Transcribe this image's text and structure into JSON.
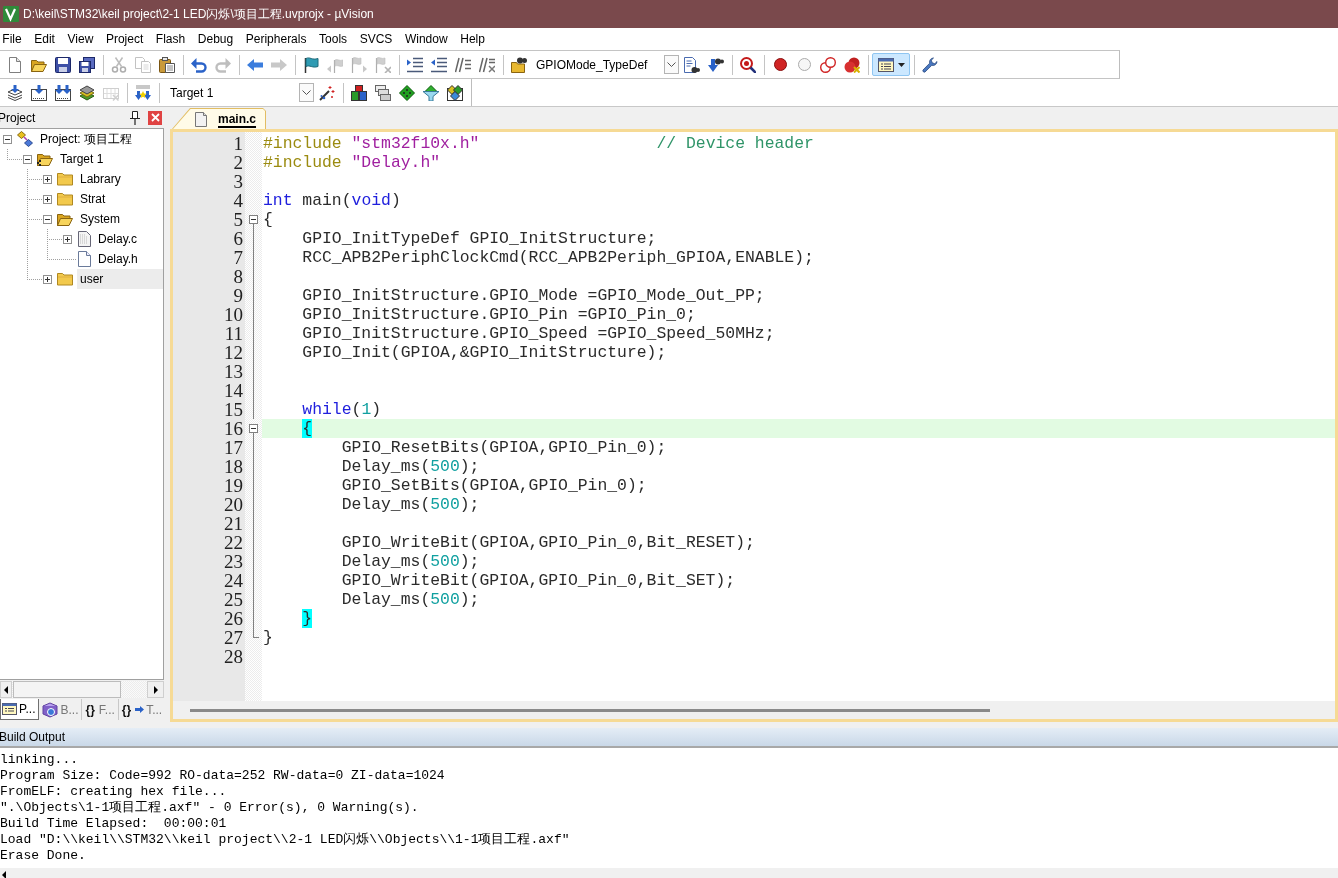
{
  "window": {
    "title": "D:\\keil\\STM32\\keil project\\2-1 LED闪烁\\项目工程.uvprojx - µVision"
  },
  "menu": [
    "File",
    "Edit",
    "View",
    "Project",
    "Flash",
    "Debug",
    "Peripherals",
    "Tools",
    "SVCS",
    "Window",
    "Help"
  ],
  "toolbar_1": [
    [
      {
        "kind": "new_file",
        "disabled": false,
        "pressed": false
      },
      {
        "kind": "open",
        "disabled": false,
        "pressed": false
      },
      {
        "kind": "save",
        "disabled": false,
        "pressed": false
      },
      {
        "kind": "save_all",
        "disabled": false,
        "pressed": false
      }
    ],
    [
      {
        "kind": "cut",
        "disabled": true,
        "pressed": false
      },
      {
        "kind": "copy",
        "disabled": true,
        "pressed": false
      },
      {
        "kind": "paste",
        "disabled": false,
        "pressed": false
      }
    ],
    [
      {
        "kind": "undo",
        "disabled": false,
        "pressed": false
      },
      {
        "kind": "redo",
        "disabled": true,
        "pressed": false
      }
    ],
    [
      {
        "kind": "nav_back",
        "disabled": false,
        "pressed": false
      },
      {
        "kind": "nav_forward",
        "disabled": true,
        "pressed": false
      }
    ],
    [
      {
        "kind": "bookmark",
        "disabled": false,
        "pressed": false
      },
      {
        "kind": "bookmark_prev",
        "disabled": true,
        "pressed": false
      },
      {
        "kind": "bookmark_next",
        "disabled": true,
        "pressed": false
      },
      {
        "kind": "bookmark_clear",
        "disabled": true,
        "pressed": false
      }
    ],
    [
      {
        "kind": "indent",
        "disabled": false,
        "pressed": false
      },
      {
        "kind": "unindent",
        "disabled": false,
        "pressed": false
      },
      {
        "kind": "comment",
        "disabled": false,
        "pressed": false
      },
      {
        "kind": "uncomment",
        "disabled": false,
        "pressed": false
      }
    ],
    [
      {
        "kind": "find_in_files",
        "disabled": false,
        "pressed": false
      },
      {
        "kind": "combo",
        "value": "GPIOMode_TypeDef"
      },
      {
        "kind": "find",
        "disabled": false,
        "pressed": false
      },
      {
        "kind": "incremental_find",
        "disabled": false,
        "pressed": false
      }
    ],
    [
      {
        "kind": "debug",
        "disabled": false,
        "pressed": false
      }
    ],
    [
      {
        "kind": "breakpoint",
        "disabled": false,
        "pressed": false
      },
      {
        "kind": "breakpoint_toggle",
        "disabled": false,
        "pressed": false
      },
      {
        "kind": "breakpoint_disable_all",
        "disabled": false,
        "pressed": false
      },
      {
        "kind": "breakpoint_kill_all",
        "disabled": false,
        "pressed": false
      }
    ],
    [
      {
        "kind": "windows",
        "disabled": false,
        "pressed": true
      }
    ],
    [
      {
        "kind": "configure",
        "disabled": false,
        "pressed": false
      }
    ]
  ],
  "toolbar_2": [
    [
      {
        "kind": "translate",
        "disabled": false,
        "pressed": false
      },
      {
        "kind": "build",
        "disabled": false,
        "pressed": false
      },
      {
        "kind": "rebuild",
        "disabled": false,
        "pressed": false
      },
      {
        "kind": "batch_build",
        "disabled": false,
        "pressed": false
      },
      {
        "kind": "stop_build",
        "disabled": true,
        "pressed": false
      }
    ],
    [
      {
        "kind": "download",
        "disabled": false,
        "pressed": false
      }
    ],
    [
      {
        "kind": "combo",
        "value": "Target 1"
      },
      {
        "kind": "target_options",
        "disabled": false,
        "pressed": false
      }
    ],
    [
      {
        "kind": "manage_components",
        "disabled": false,
        "pressed": false
      },
      {
        "kind": "select_packs",
        "disabled": false,
        "pressed": false
      },
      {
        "kind": "run_time_env",
        "disabled": false,
        "pressed": false
      },
      {
        "kind": "pack_filter",
        "disabled": false,
        "pressed": false
      },
      {
        "kind": "pack_installer",
        "disabled": false,
        "pressed": false
      }
    ]
  ],
  "project_panel": {
    "title": "Project",
    "tree": [
      {
        "label": "Project: 项目工程",
        "kind": "project",
        "expanded": true,
        "selected": false,
        "children": [
          {
            "label": "Target 1",
            "kind": "target",
            "expanded": true,
            "selected": false,
            "children": [
              {
                "label": "Labrary",
                "kind": "group",
                "expanded": false,
                "selected": false
              },
              {
                "label": "Strat",
                "kind": "group",
                "expanded": false,
                "selected": false
              },
              {
                "label": "System",
                "kind": "group",
                "expanded": true,
                "selected": false,
                "children": [
                  {
                    "label": "Delay.c",
                    "kind": "source",
                    "expanded": false,
                    "selected": false
                  },
                  {
                    "label": "Delay.h",
                    "kind": "header",
                    "selected": false
                  }
                ]
              },
              {
                "label": "user",
                "kind": "group",
                "expanded": false,
                "selected": true
              }
            ]
          }
        ]
      }
    ],
    "tabs": [
      {
        "kind": "project",
        "label": "P...",
        "selected": true
      },
      {
        "kind": "books",
        "label": "B...",
        "selected": false
      },
      {
        "kind": "functions",
        "glyph": "{}",
        "label": "F...",
        "selected": false
      },
      {
        "kind": "templates",
        "glyph": "{}",
        "label": "T...",
        "selected": false
      }
    ]
  },
  "editor": {
    "tabs": [
      {
        "label": "main.c",
        "selected": true
      }
    ],
    "lines": [
      {
        "number": "1",
        "kind": "plain",
        "current": false,
        "segments": [
          {
            "kind": "preproc",
            "text": "#include "
          },
          {
            "kind": "string",
            "text": "\"stm32f10x.h\""
          },
          {
            "kind": "comment",
            "text": "                  // Device header"
          }
        ]
      },
      {
        "number": "2",
        "kind": "plain",
        "current": false,
        "segments": [
          {
            "kind": "preproc",
            "text": "#include "
          },
          {
            "kind": "string",
            "text": "\"Delay.h\""
          }
        ]
      },
      {
        "number": "3",
        "kind": "plain",
        "current": false
      },
      {
        "number": "4",
        "kind": "plain",
        "current": false,
        "segments": [
          {
            "kind": "keyword",
            "text": "int"
          },
          {
            "kind": "plain",
            "text": " main("
          },
          {
            "kind": "keyword",
            "text": "void"
          },
          {
            "kind": "plain",
            "text": ")"
          }
        ]
      },
      {
        "number": "5",
        "kind": "fold_start",
        "current": false,
        "segments": [
          {
            "kind": "plain",
            "text": "{"
          }
        ]
      },
      {
        "number": "6",
        "kind": "fold_body",
        "current": false,
        "segments": [
          {
            "kind": "plain",
            "text": "    GPIO_InitTypeDef GPIO_InitStructure;"
          }
        ]
      },
      {
        "number": "7",
        "kind": "fold_body",
        "current": false,
        "segments": [
          {
            "kind": "plain",
            "text": "    RCC_APB2PeriphClockCmd(RCC_APB2Periph_GPIOA,ENABLE);"
          }
        ]
      },
      {
        "number": "8",
        "kind": "fold_body",
        "current": false
      },
      {
        "number": "9",
        "kind": "fold_body",
        "current": false,
        "segments": [
          {
            "kind": "plain",
            "text": "    GPIO_InitStructure.GPIO_Mode =GPIO_Mode_Out_PP;"
          }
        ]
      },
      {
        "number": "10",
        "kind": "fold_body",
        "current": false,
        "segments": [
          {
            "kind": "plain",
            "text": "    GPIO_InitStructure.GPIO_Pin =GPIO_Pin_0;"
          }
        ]
      },
      {
        "number": "11",
        "kind": "fold_body",
        "current": false,
        "segments": [
          {
            "kind": "plain",
            "text": "    GPIO_InitStructure.GPIO_Speed =GPIO_Speed_50MHz;"
          }
        ]
      },
      {
        "number": "12",
        "kind": "fold_body",
        "current": false,
        "segments": [
          {
            "kind": "plain",
            "text": "    GPIO_Init(GPIOA,&GPIO_InitStructure);"
          }
        ]
      },
      {
        "number": "13",
        "kind": "fold_body",
        "current": false
      },
      {
        "number": "14",
        "kind": "fold_body",
        "current": false
      },
      {
        "number": "15",
        "kind": "fold_body",
        "current": false,
        "segments": [
          {
            "kind": "keyword",
            "text": "    while"
          },
          {
            "kind": "plain",
            "text": "("
          },
          {
            "kind": "number",
            "text": "1"
          },
          {
            "kind": "plain",
            "text": ")"
          }
        ]
      },
      {
        "number": "16",
        "kind": "fold_start",
        "current": true,
        "segments": [
          {
            "kind": "brace_match",
            "text": "    {"
          }
        ]
      },
      {
        "number": "17",
        "kind": "fold_body",
        "current": false,
        "segments": [
          {
            "kind": "plain",
            "text": "        GPIO_ResetBits(GPIOA,GPIO_Pin_0);"
          }
        ]
      },
      {
        "number": "18",
        "kind": "fold_body",
        "current": false,
        "segments": [
          {
            "kind": "plain",
            "text": "        Delay_ms("
          },
          {
            "kind": "number",
            "text": "500"
          },
          {
            "kind": "plain",
            "text": ");"
          }
        ]
      },
      {
        "number": "19",
        "kind": "fold_body",
        "current": false,
        "segments": [
          {
            "kind": "plain",
            "text": "        GPIO_SetBits(GPIOA,GPIO_Pin_0);"
          }
        ]
      },
      {
        "number": "20",
        "kind": "fold_body",
        "current": false,
        "segments": [
          {
            "kind": "plain",
            "text": "        Delay_ms("
          },
          {
            "kind": "number",
            "text": "500"
          },
          {
            "kind": "plain",
            "text": ");"
          }
        ]
      },
      {
        "number": "21",
        "kind": "fold_body",
        "current": false
      },
      {
        "number": "22",
        "kind": "fold_body",
        "current": false,
        "segments": [
          {
            "kind": "plain",
            "text": "        GPIO_WriteBit(GPIOA,GPIO_Pin_0,Bit_RESET);"
          }
        ]
      },
      {
        "number": "23",
        "kind": "fold_body",
        "current": false,
        "segments": [
          {
            "kind": "plain",
            "text": "        Delay_ms("
          },
          {
            "kind": "number",
            "text": "500"
          },
          {
            "kind": "plain",
            "text": ");"
          }
        ]
      },
      {
        "number": "24",
        "kind": "fold_body",
        "current": false,
        "segments": [
          {
            "kind": "plain",
            "text": "        GPIO_WriteBit(GPIOA,GPIO_Pin_0,Bit_SET);"
          }
        ]
      },
      {
        "number": "25",
        "kind": "fold_body",
        "current": false,
        "segments": [
          {
            "kind": "plain",
            "text": "        Delay_ms("
          },
          {
            "kind": "number",
            "text": "500"
          },
          {
            "kind": "plain",
            "text": ");"
          }
        ]
      },
      {
        "number": "26",
        "kind": "fold_body",
        "current": false,
        "segments": [
          {
            "kind": "brace_match",
            "text": "    }"
          }
        ]
      },
      {
        "number": "27",
        "kind": "fold_end",
        "current": false,
        "segments": [
          {
            "kind": "plain",
            "text": "}"
          }
        ]
      },
      {
        "number": "28",
        "kind": "plain",
        "current": false
      }
    ]
  },
  "output": {
    "title": "Build Output",
    "lines": [
      "linking...",
      "Program Size: Code=992 RO-data=252 RW-data=0 ZI-data=1024",
      "FromELF: creating hex file...",
      "\".\\Objects\\1-1项目工程.axf\" - 0 Error(s), 0 Warning(s).",
      "Build Time Elapsed:  00:00:01",
      "Load \"D:\\\\keil\\\\STM32\\\\keil project\\\\2-1 LED闪烁\\\\Objects\\\\1-1项目工程.axf\"",
      "Erase Done."
    ]
  }
}
